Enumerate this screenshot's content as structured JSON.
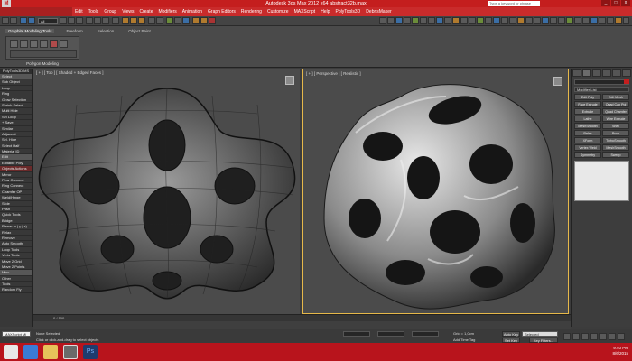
{
  "window": {
    "title": "Autodesk 3ds Max  2012 x64      abstract32b.max",
    "search_placeholder": "Type a keyword or phrase",
    "controls": [
      "_",
      "□",
      "x"
    ]
  },
  "menu": [
    "Edit",
    "Tools",
    "Group",
    "Views",
    "Create",
    "Modifiers",
    "Animation",
    "Graph Editors",
    "Rendering",
    "Customize",
    "MAXScript",
    "Help",
    "PolyTools3D",
    "DebrisMaker"
  ],
  "toolbar": {
    "selection_filter": "All"
  },
  "ribbon": {
    "tabs": [
      "Graphite Modeling Tools",
      "Freeform",
      "Selection",
      "Object Paint"
    ],
    "panel_label": "Polygon Modeling"
  },
  "left_panel": {
    "title": "PolyTools3D.MS",
    "items": [
      "Select",
      "Sub Object",
      "Loop",
      "Ring",
      "Grow Selection",
      "Shrink Select",
      "Multi Hide",
      "Sel Loop",
      "+ Save",
      "Similar",
      "Adjacent",
      "Sel. Hide",
      "Select Half",
      "Material ID",
      "Edit",
      "Editable Poly",
      "Objects Actions",
      "Mirror",
      "Flow Connect",
      "Ring Connect",
      "Chamfer OP",
      "Weld/Hinge",
      "Slide",
      "Push",
      "Quick Tools",
      "Bridge",
      "Planar (x | y | z)",
      "Relax",
      "Remove",
      "Auto Smooth",
      "Loop Tools",
      "Verts Tools",
      "Move 2 Grid",
      "Move 2 Points",
      "Misc",
      "Other",
      "Tools",
      "Random Fly"
    ]
  },
  "viewports": {
    "top_label": "[ + ] [ Top ] [ Shaded + Edged Faces ]",
    "perspective_label": "[ + ] [ Perspective ] [ Realistic ]"
  },
  "command_panel": {
    "modifier_list": "Modifier List",
    "modifiers": [
      "Edit Poly",
      "Edit Mesh",
      "Face Extrude",
      "Quad Cap Pol",
      "Extrude",
      "Quad Chamfer",
      "Lathe",
      "Wire Extrude",
      "MeshSmooth",
      "Shell",
      "Relax",
      "Push",
      "XForm",
      "TurboSmooth",
      "Vertex Weld",
      "MeshSmooth",
      "Symmetry",
      "Sweep"
    ]
  },
  "timeline": {
    "frame": "0 / 100"
  },
  "status": {
    "script_label": "MAXScript Mi",
    "selection": "None Selected",
    "prompt": "Click or click-and-drag to select objects",
    "grid": "Grid = 1,0cm",
    "time_tag": "Add Time Tag",
    "auto_key": "Auto Key",
    "selected": "Selected",
    "set_key": "Set Key",
    "key_filters": "Key Filters..."
  },
  "taskbar": {
    "time": "9:40 PM",
    "date": "8/6/2015",
    "apps": [
      "ie",
      "explorer",
      "3dsmax",
      "photoshop"
    ]
  },
  "colors": {
    "accent_red": "#c41e1e",
    "viewport_bg": "#4b4b4b",
    "active_viewport_border": "#e6b84a"
  }
}
